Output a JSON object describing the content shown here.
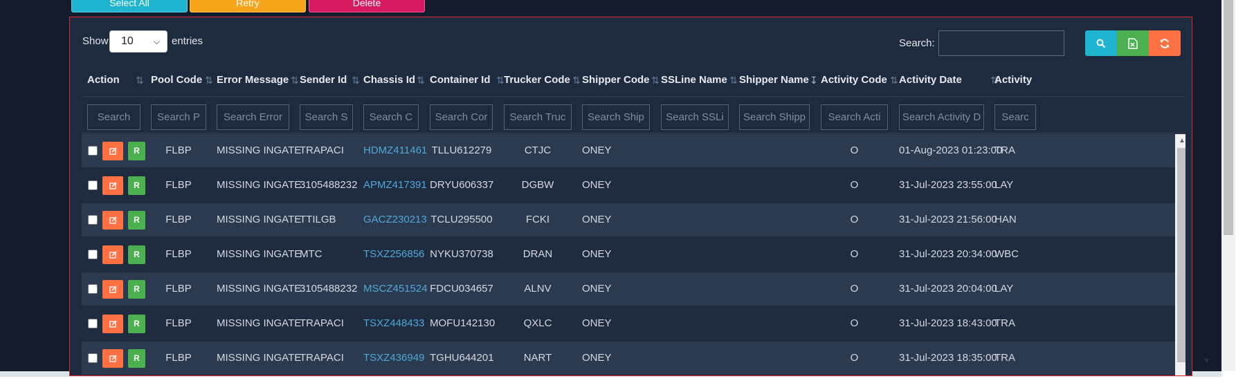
{
  "toolbar": {
    "select_all": "Select All",
    "retry": "Retry",
    "delete": "Delete"
  },
  "length": {
    "show": "Show",
    "value": "10",
    "entries": "entries"
  },
  "search": {
    "label": "Search:",
    "value": ""
  },
  "icons": {
    "search": "search-icon",
    "excel": "excel-icon",
    "refresh": "refresh-icon",
    "edit": "edit-icon",
    "checkbox": "checkbox-icon"
  },
  "colors": {
    "panel_border": "#e0262e",
    "edit_button": "#ff7043",
    "r_button": "#4caf50",
    "link": "#4fa8d8"
  },
  "columns": [
    "Action",
    "Pool Code",
    "Error Message",
    "Sender Id",
    "Chassis Id",
    "Container Id",
    "Trucker Code",
    "Shipper Code",
    "SSLine Name",
    "Shipper Name",
    "Activity Code",
    "Activity Date",
    "Activity"
  ],
  "filters": [
    "Search",
    "Search P",
    "Search Error",
    "Search S",
    "Search C",
    "Search Cor",
    "Search Truc",
    "Search Ship",
    "Search SSLi",
    "Search Shipp",
    "Search Acti",
    "Search Activity D",
    "Searc"
  ],
  "row_button_label": "R",
  "rows": [
    {
      "pool": "FLBP",
      "error": "MISSING INGATE",
      "sender": "TRAPACI",
      "chassis": "HDMZ411461",
      "container": "TLLU612279",
      "trucker": "CTJC",
      "shipper_code": "ONEY",
      "ssline": "",
      "shipper_name": "",
      "activity_code": "O",
      "activity_date": "01-Aug-2023 01:23:00",
      "activity": "TRA"
    },
    {
      "pool": "FLBP",
      "error": "MISSING INGATE",
      "sender": "3105488232",
      "chassis": "APMZ417391",
      "container": "DRYU606337",
      "trucker": "DGBW",
      "shipper_code": "ONEY",
      "ssline": "",
      "shipper_name": "",
      "activity_code": "O",
      "activity_date": "31-Jul-2023 23:55:00",
      "activity": "LAY"
    },
    {
      "pool": "FLBP",
      "error": "MISSING INGATE",
      "sender": "TTILGB",
      "chassis": "GACZ230213",
      "container": "TCLU295500",
      "trucker": "FCKI",
      "shipper_code": "ONEY",
      "ssline": "",
      "shipper_name": "",
      "activity_code": "O",
      "activity_date": "31-Jul-2023 21:56:00",
      "activity": "HAN"
    },
    {
      "pool": "FLBP",
      "error": "MISSING INGATE",
      "sender": "MTC",
      "chassis": "TSXZ256856",
      "container": "NYKU370738",
      "trucker": "DRAN",
      "shipper_code": "ONEY",
      "ssline": "",
      "shipper_name": "",
      "activity_code": "O",
      "activity_date": "31-Jul-2023 20:34:00",
      "activity": "WBC"
    },
    {
      "pool": "FLBP",
      "error": "MISSING INGATE",
      "sender": "3105488232",
      "chassis": "MSCZ451524",
      "container": "FDCU034657",
      "trucker": "ALNV",
      "shipper_code": "ONEY",
      "ssline": "",
      "shipper_name": "",
      "activity_code": "O",
      "activity_date": "31-Jul-2023 20:04:00",
      "activity": "LAY"
    },
    {
      "pool": "FLBP",
      "error": "MISSING INGATE",
      "sender": "TRAPACI",
      "chassis": "TSXZ448433",
      "container": "MOFU142130",
      "trucker": "QXLC",
      "shipper_code": "ONEY",
      "ssline": "",
      "shipper_name": "",
      "activity_code": "O",
      "activity_date": "31-Jul-2023 18:43:00",
      "activity": "TRA"
    },
    {
      "pool": "FLBP",
      "error": "MISSING INGATE",
      "sender": "TRAPACI",
      "chassis": "TSXZ436949",
      "container": "TGHU644201",
      "trucker": "NART",
      "shipper_code": "ONEY",
      "ssline": "",
      "shipper_name": "",
      "activity_code": "O",
      "activity_date": "31-Jul-2023 18:35:00",
      "activity": "TRA"
    }
  ]
}
